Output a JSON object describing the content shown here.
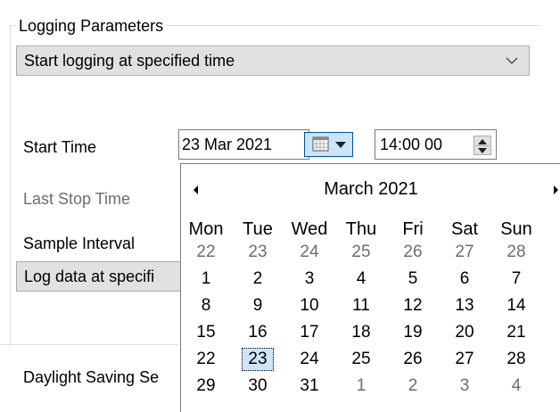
{
  "logging": {
    "group_title": "Logging Parameters",
    "mode_value": "Start logging at specified time",
    "start_time_label": "Start Time",
    "start_date_value": "23 Mar 2021",
    "start_time_value": "14:00 00",
    "last_stop_label": "Last Stop Time",
    "sample_interval_label": "Sample Interval",
    "interval_value": "Log data at specifi",
    "dst_label": "Daylight Saving Se"
  },
  "calendar": {
    "month_title": "March 2021",
    "day_names": [
      "Mon",
      "Tue",
      "Wed",
      "Thu",
      "Fri",
      "Sat",
      "Sun"
    ],
    "weeks": [
      [
        {
          "d": "22",
          "o": true
        },
        {
          "d": "23",
          "o": true
        },
        {
          "d": "24",
          "o": true
        },
        {
          "d": "25",
          "o": true
        },
        {
          "d": "26",
          "o": true
        },
        {
          "d": "27",
          "o": true
        },
        {
          "d": "28",
          "o": true
        }
      ],
      [
        {
          "d": "1"
        },
        {
          "d": "2"
        },
        {
          "d": "3"
        },
        {
          "d": "4"
        },
        {
          "d": "5"
        },
        {
          "d": "6"
        },
        {
          "d": "7"
        }
      ],
      [
        {
          "d": "8"
        },
        {
          "d": "9"
        },
        {
          "d": "10"
        },
        {
          "d": "11"
        },
        {
          "d": "12"
        },
        {
          "d": "13"
        },
        {
          "d": "14"
        }
      ],
      [
        {
          "d": "15"
        },
        {
          "d": "16"
        },
        {
          "d": "17"
        },
        {
          "d": "18"
        },
        {
          "d": "19"
        },
        {
          "d": "20"
        },
        {
          "d": "21"
        }
      ],
      [
        {
          "d": "22"
        },
        {
          "d": "23",
          "today": true
        },
        {
          "d": "24"
        },
        {
          "d": "25"
        },
        {
          "d": "26"
        },
        {
          "d": "27"
        },
        {
          "d": "28"
        }
      ],
      [
        {
          "d": "29"
        },
        {
          "d": "30"
        },
        {
          "d": "31"
        },
        {
          "d": "1",
          "o": true
        },
        {
          "d": "2",
          "o": true
        },
        {
          "d": "3",
          "o": true
        },
        {
          "d": "4",
          "o": true
        }
      ]
    ],
    "selected_day": "23",
    "icons": {
      "prev": "chevron-left-icon",
      "next": "chevron-right-icon",
      "calendar": "calendar-icon",
      "dropdown": "chevron-down-icon"
    }
  },
  "colors": {
    "selection": "#cce4f7",
    "accent": "#005499",
    "disabled_text": "#6d6d6d"
  }
}
